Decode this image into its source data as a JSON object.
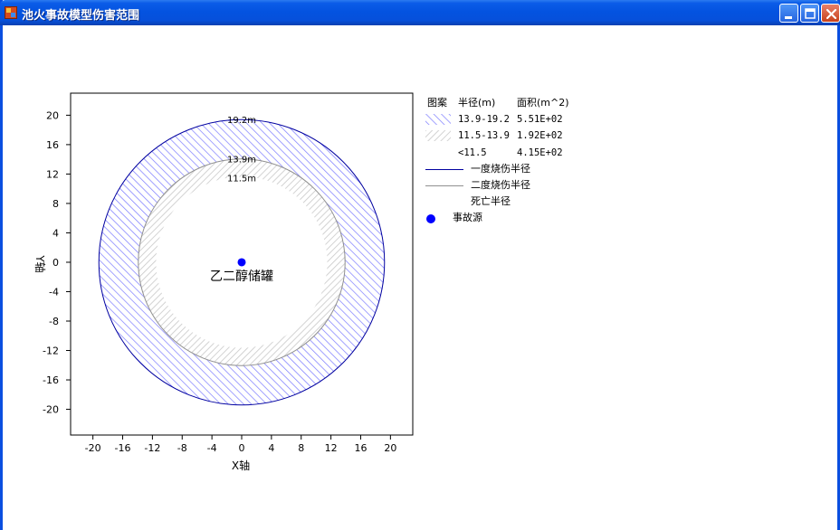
{
  "window": {
    "title": "池火事故模型伤害范围"
  },
  "colors": {
    "titlebar": "#0453e0",
    "ring_outer": "#7a7aff",
    "ring_inner": "#c0c0c0",
    "first_degree_line": "#0000a0",
    "second_degree_line": "#909090",
    "source": "#0000ff"
  },
  "icons": [
    "app-icon",
    "minimize-icon",
    "maximize-icon",
    "close-icon"
  ],
  "chart_data": {
    "type": "scatter",
    "xlabel": "X轴",
    "ylabel": "Y轴",
    "xlim": [
      -23,
      23
    ],
    "ylim": [
      -23.5,
      23
    ],
    "xticks": [
      -20,
      -16,
      -12,
      -8,
      -4,
      0,
      4,
      8,
      12,
      16,
      20
    ],
    "yticks": [
      20,
      16,
      12,
      8,
      4,
      0,
      -4,
      -8,
      -12,
      -16,
      -20
    ],
    "grid": false,
    "circles": [
      {
        "radius": 19.2,
        "label": "19.2m"
      },
      {
        "radius": 13.9,
        "label": "13.9m"
      },
      {
        "radius": 11.5,
        "label": "11.5m"
      }
    ],
    "source": {
      "x": 0,
      "y": 0,
      "label": "乙二醇储罐"
    }
  },
  "legend": {
    "header": {
      "pattern": "图案",
      "radius": "半径(m)",
      "area": "面积(m^2)"
    },
    "rows": [
      {
        "range": "13.9-19.2",
        "area": "5.51E+02"
      },
      {
        "range": "11.5-13.9",
        "area": "1.92E+02"
      },
      {
        "range": "<11.5",
        "area": "4.15E+02"
      }
    ],
    "lines": [
      {
        "label": "一度烧伤半径"
      },
      {
        "label": "二度烧伤半径"
      },
      {
        "label": "死亡半径"
      }
    ],
    "source_label": "事故源"
  }
}
